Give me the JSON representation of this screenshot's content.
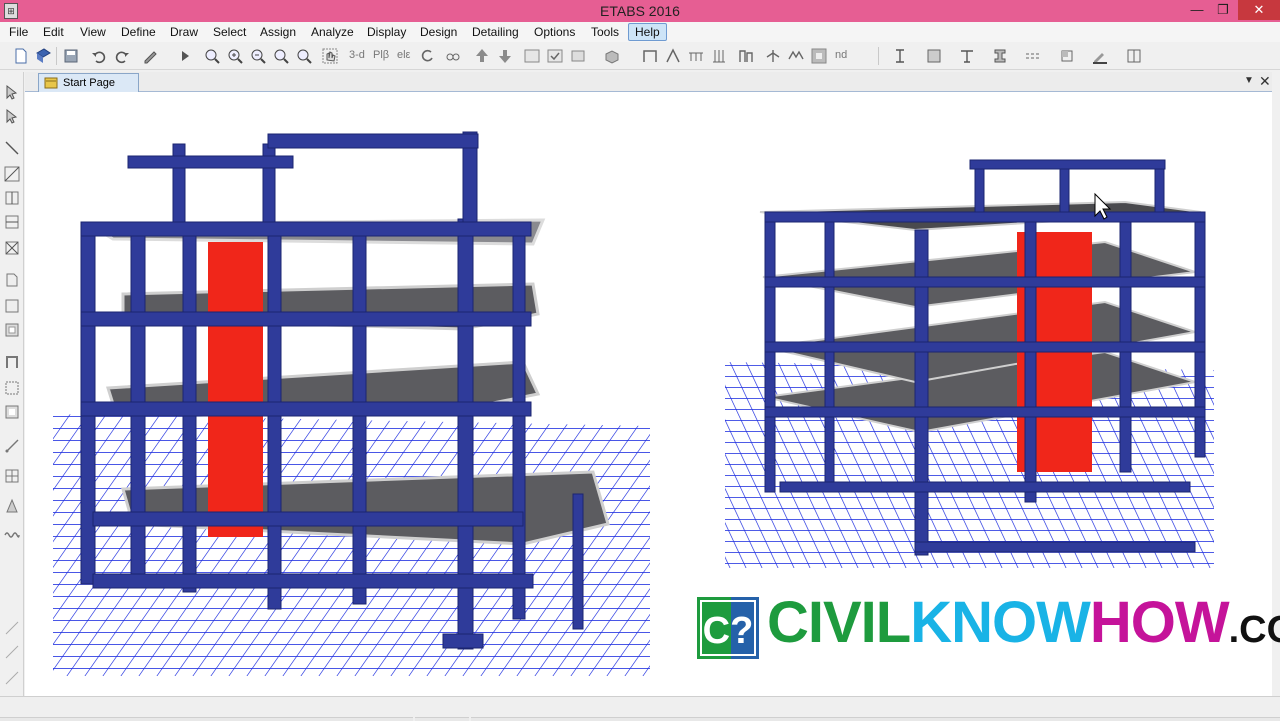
{
  "window": {
    "title": "ETABS 2016",
    "min_glyph": "—",
    "max_glyph": "❐",
    "close_glyph": "✕"
  },
  "menu": [
    "File",
    "Edit",
    "View",
    "Define",
    "Draw",
    "Select",
    "Assign",
    "Analyze",
    "Display",
    "Design",
    "Detailing",
    "Options",
    "Tools",
    "Help"
  ],
  "toolbar": {
    "view_3d_label": "3-d",
    "plan_label": "Plβ",
    "elev_label": "elε",
    "nd_label": "nd"
  },
  "tabs": {
    "start_page": "Start Page",
    "dropdown_glyph": "▼",
    "close_glyph": "✕"
  },
  "logo": {
    "mark": "C?",
    "civil": "CIVIL",
    "know": "KNOW",
    "how": "HOW",
    "dotcom": ".COM"
  },
  "colors": {
    "titlebar": "#e65e93",
    "frame_blue": "#2f3b9a",
    "shear_wall_red": "#f0261a",
    "slab_gray": "#5c5c60",
    "grid_blue": "#1f2fe0",
    "logo_green": "#1e9b3e",
    "logo_cyan": "#19b3e6",
    "logo_magenta": "#c5139a"
  }
}
